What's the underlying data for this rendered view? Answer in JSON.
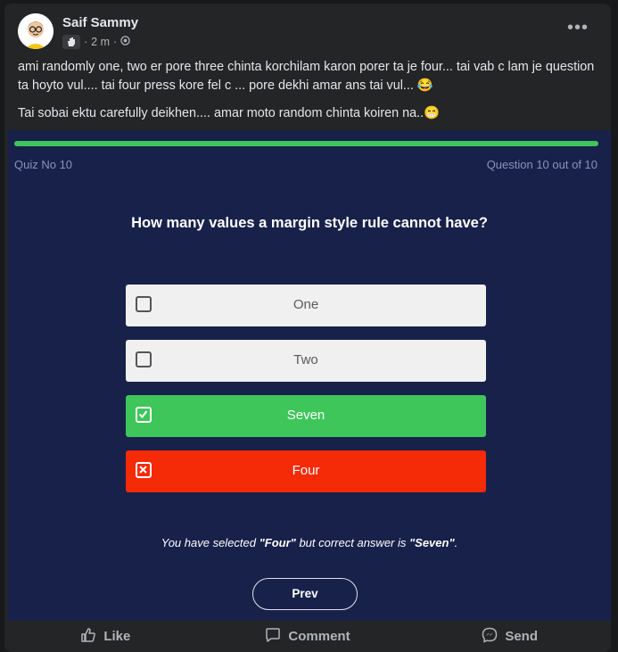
{
  "post": {
    "author": "Saif Sammy",
    "time": "2 m",
    "text_line1": "ami randomly one, two er pore three chinta korchilam karon porer ta je four... tai vab c lam je question ta hoyto vul.... tai four press kore fel c ... pore dekhi amar ans tai vul... 😂",
    "text_line2": "Tai sobai ektu carefully deikhen.... amar moto random chinta koiren na..😁"
  },
  "quiz": {
    "quiz_no": "Quiz No 10",
    "question_count": "Question 10 out of 10",
    "progress": 1.0,
    "question": "How many values a margin style rule cannot have?",
    "options": [
      {
        "label": "One",
        "state": "unchecked"
      },
      {
        "label": "Two",
        "state": "unchecked"
      },
      {
        "label": "Seven",
        "state": "correct"
      },
      {
        "label": "Four",
        "state": "wrong"
      }
    ],
    "result_prefix": "You have selected ",
    "result_selected": "\"Four\"",
    "result_middle": " but correct answer is ",
    "result_correct": "\"Seven\"",
    "result_suffix": ".",
    "prev_label": "Prev"
  },
  "actions": {
    "like": "Like",
    "comment": "Comment",
    "send": "Send"
  },
  "colors": {
    "correct": "#3ec65a",
    "wrong": "#f52a06",
    "quiz_bg": "#18214a"
  }
}
